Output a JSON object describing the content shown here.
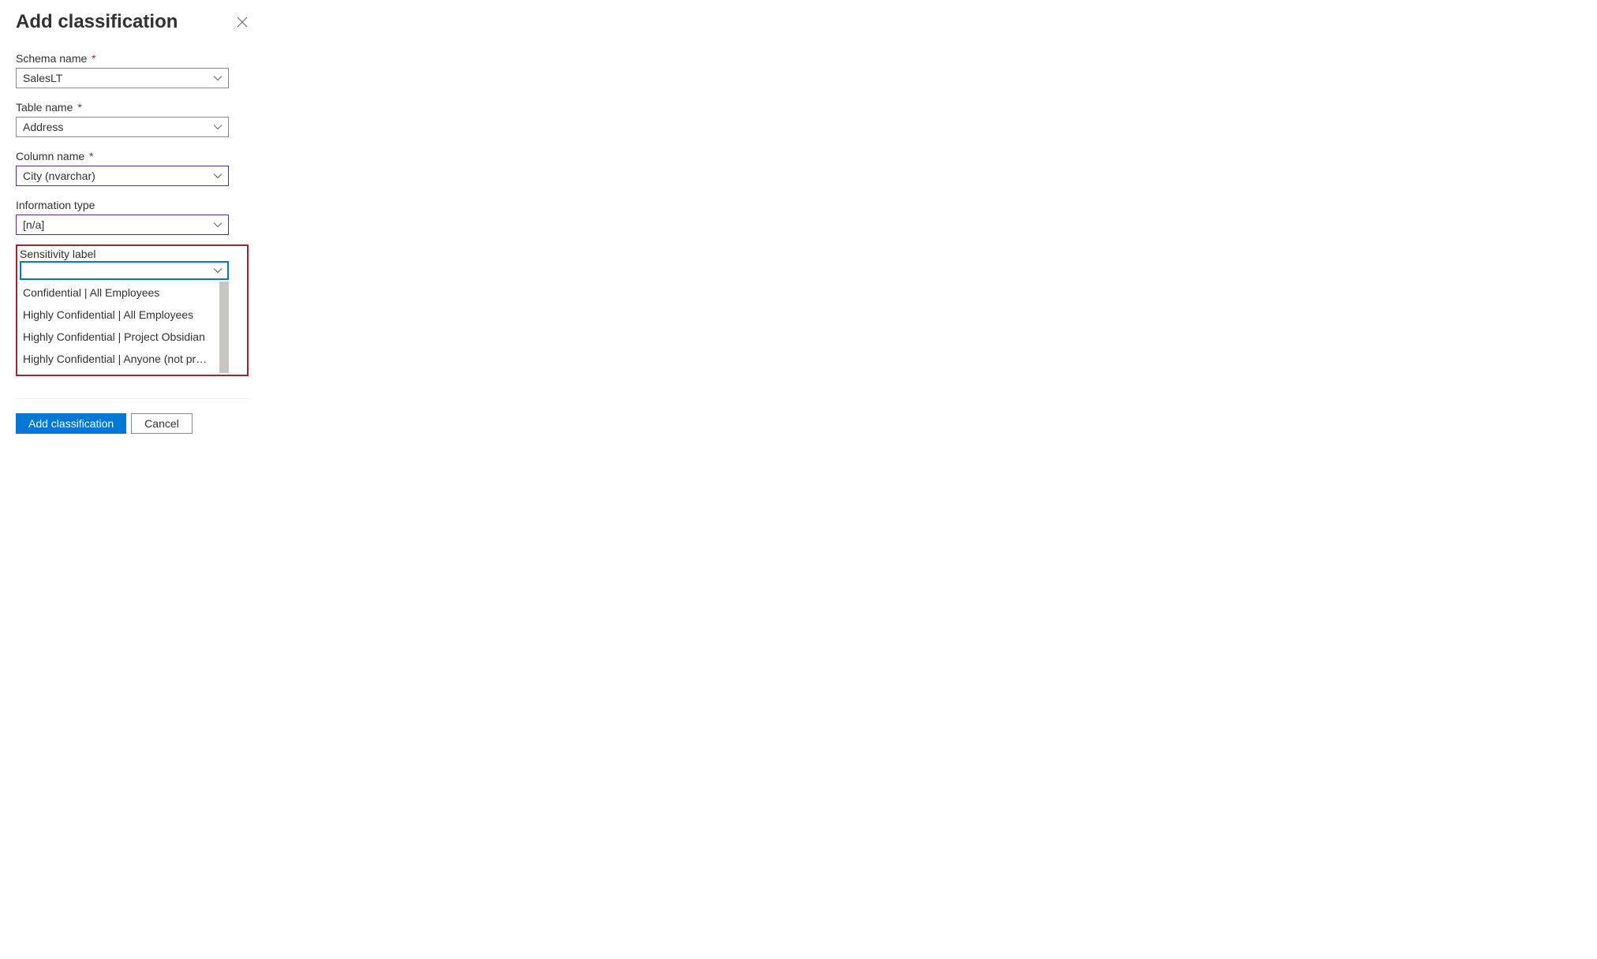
{
  "header": {
    "title": "Add classification"
  },
  "fields": {
    "schema": {
      "label": "Schema name",
      "value": "SalesLT",
      "required": true
    },
    "table": {
      "label": "Table name",
      "value": "Address",
      "required": true
    },
    "column": {
      "label": "Column name",
      "value": "City (nvarchar)",
      "required": true
    },
    "infoType": {
      "label": "Information type",
      "value": "[n/a]",
      "required": false
    },
    "sensitivity": {
      "label": "Sensitivity label",
      "value": "",
      "options": [
        "Confidential | All Employees",
        "Highly Confidential | All Employees",
        "Highly Confidential | Project Obsidian",
        "Highly Confidential | Anyone (not protected)"
      ]
    }
  },
  "buttons": {
    "primary": "Add classification",
    "secondary": "Cancel"
  }
}
